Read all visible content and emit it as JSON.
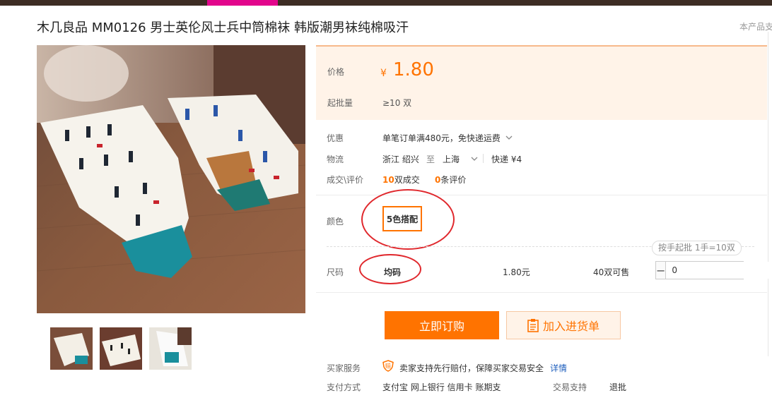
{
  "product": {
    "title": "木几良品 MM0126 男士英伦风士兵中筒棉袜 韩版潮男袜纯棉吸汗",
    "side_note": "本产品支"
  },
  "price": {
    "label": "价格",
    "currency": "¥",
    "value": "1.80",
    "moq_label": "起批量",
    "moq_value": "≥10 双"
  },
  "info": {
    "promo_label": "优惠",
    "promo_value": "单笔订单满480元，免快递运费",
    "logistics_label": "物流",
    "from": "浙江 绍兴",
    "to_word": "至",
    "to_city": "上海",
    "express": "快递 ¥4",
    "deals_label": "成交\\评价",
    "deals_count": "10",
    "deals_unit": "双成交",
    "reviews_count": "0",
    "reviews_unit": "条评价"
  },
  "spec": {
    "color_label": "颜色",
    "color_option": "5色搭配",
    "batch_pill": "按手起批 1手=10双",
    "size_label": "尺码",
    "size_value": "均码",
    "size_price": "1.80元",
    "stock": "40双可售",
    "quantity": "0",
    "minus": "−",
    "plus": "+"
  },
  "actions": {
    "buy": "立即订购",
    "cart": "加入进货单"
  },
  "service": {
    "label": "买家服务",
    "text": "卖家支持先行赔付，保障买家交易安全",
    "detail_link": "详情",
    "pay_label": "支付方式",
    "pay_methods": "支付宝  网上银行  信用卡  账期支",
    "trade_label": "交易支持",
    "trade_value": "退批"
  },
  "colors": {
    "accent": "#ff7300",
    "price_bg": "#fff3e8",
    "annotation": "#e0282d",
    "topbar": "#3d2d24",
    "topbar_highlight": "#e2058c"
  }
}
